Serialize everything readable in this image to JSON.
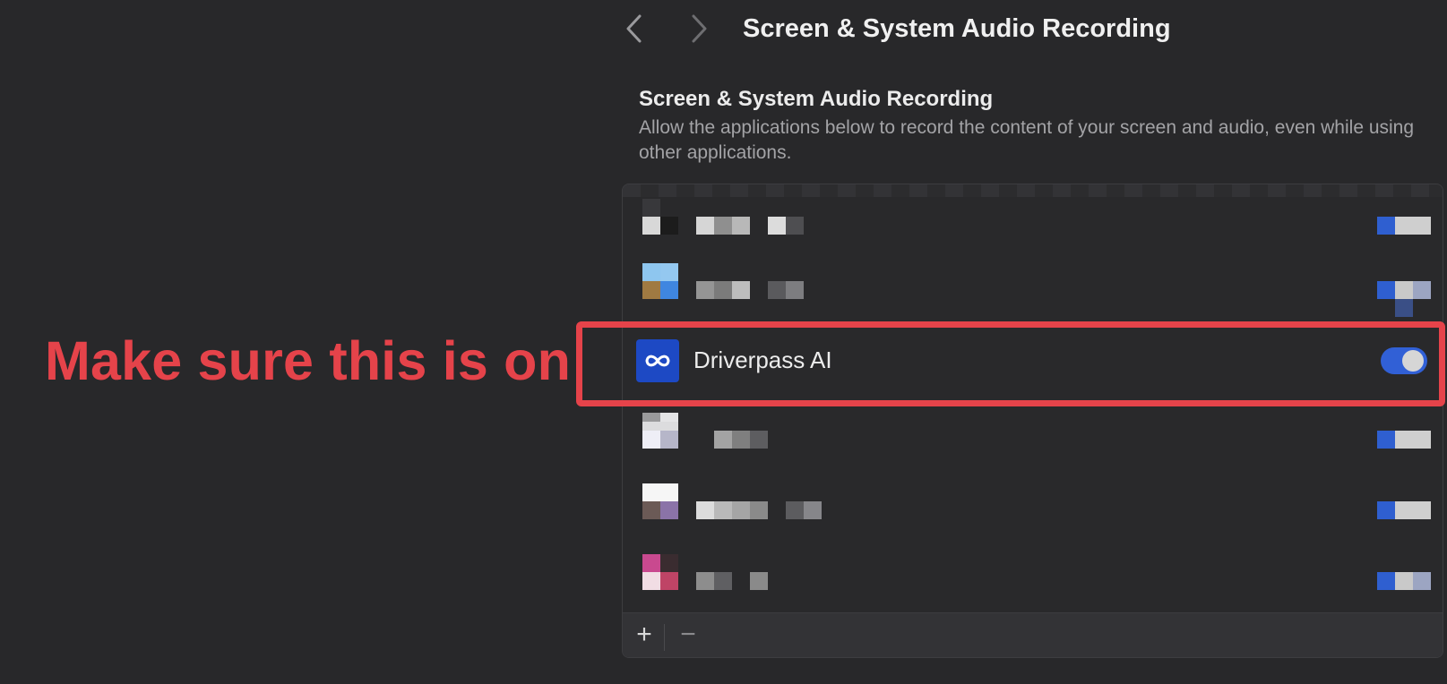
{
  "annotation": {
    "text": "Make sure this is on",
    "color": "#e5434a"
  },
  "toolbar": {
    "back_icon": "chevron-left-icon",
    "forward_icon": "chevron-right-icon",
    "title": "Screen & System Audio Recording"
  },
  "section": {
    "title": "Screen & System Audio Recording",
    "description": "Allow the applications below to record the content of your screen and audio, even while using other applications."
  },
  "apps": {
    "featured": {
      "name": "Driverpass AI",
      "icon": "infinity-icon",
      "icon_color": "#1d49c4",
      "enabled": true,
      "toggle_color": "#3160d6"
    }
  },
  "footer": {
    "add_label": "+",
    "remove_label": "−"
  }
}
